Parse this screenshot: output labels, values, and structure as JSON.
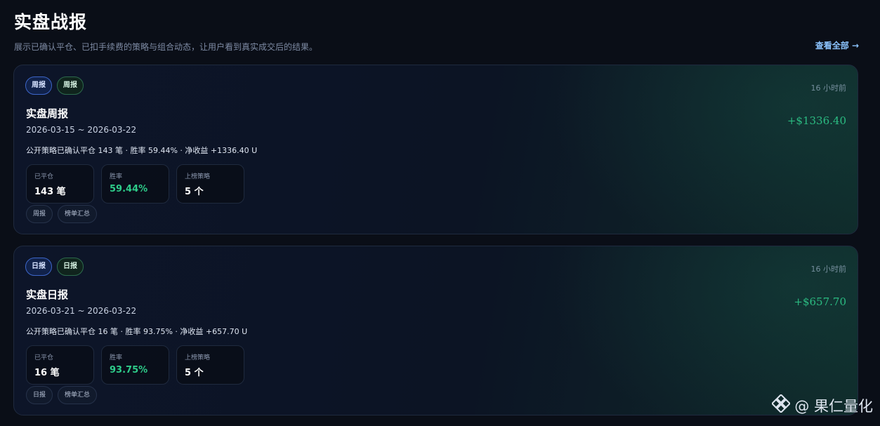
{
  "header": {
    "title": "实盘战报",
    "subtitle": "展示已确认平仓、已扣手续费的策略与组合动态，让用户看到真实成交后的结果。",
    "view_all": "查看全部 →"
  },
  "reports": [
    {
      "badges": [
        "周报",
        "周报"
      ],
      "time_ago": "16 小时前",
      "title": "实盘周报",
      "date_range": "2026-03-15 ~ 2026-03-22",
      "summary": "公开策略已确认平仓 143 笔 · 胜率 59.44% · 净收益 +1336.40 U",
      "pnl": "+$1336.40",
      "stats": [
        {
          "label": "已平仓",
          "value": "143 笔"
        },
        {
          "label": "胜率",
          "value": "59.44%"
        },
        {
          "label": "上榜策略",
          "value": "5 个"
        }
      ],
      "tags": [
        "周报",
        "榜单汇总"
      ]
    },
    {
      "badges": [
        "日报",
        "日报"
      ],
      "time_ago": "16 小时前",
      "title": "实盘日报",
      "date_range": "2026-03-21 ~ 2026-03-22",
      "summary": "公开策略已确认平仓 16 笔 · 胜率 93.75% · 净收益 +657.70 U",
      "pnl": "+$657.70",
      "stats": [
        {
          "label": "已平仓",
          "value": "16 笔"
        },
        {
          "label": "胜率",
          "value": "93.75%"
        },
        {
          "label": "上榜策略",
          "value": "5 个"
        }
      ],
      "tags": [
        "日报",
        "榜单汇总"
      ]
    }
  ],
  "watermark": {
    "text": "@ 果仁量化",
    "icon": "logo-diamond-icon"
  },
  "colors": {
    "profit": "#2ecc8a",
    "accent_link": "#8cc4ff",
    "background": "#0a0e17"
  }
}
